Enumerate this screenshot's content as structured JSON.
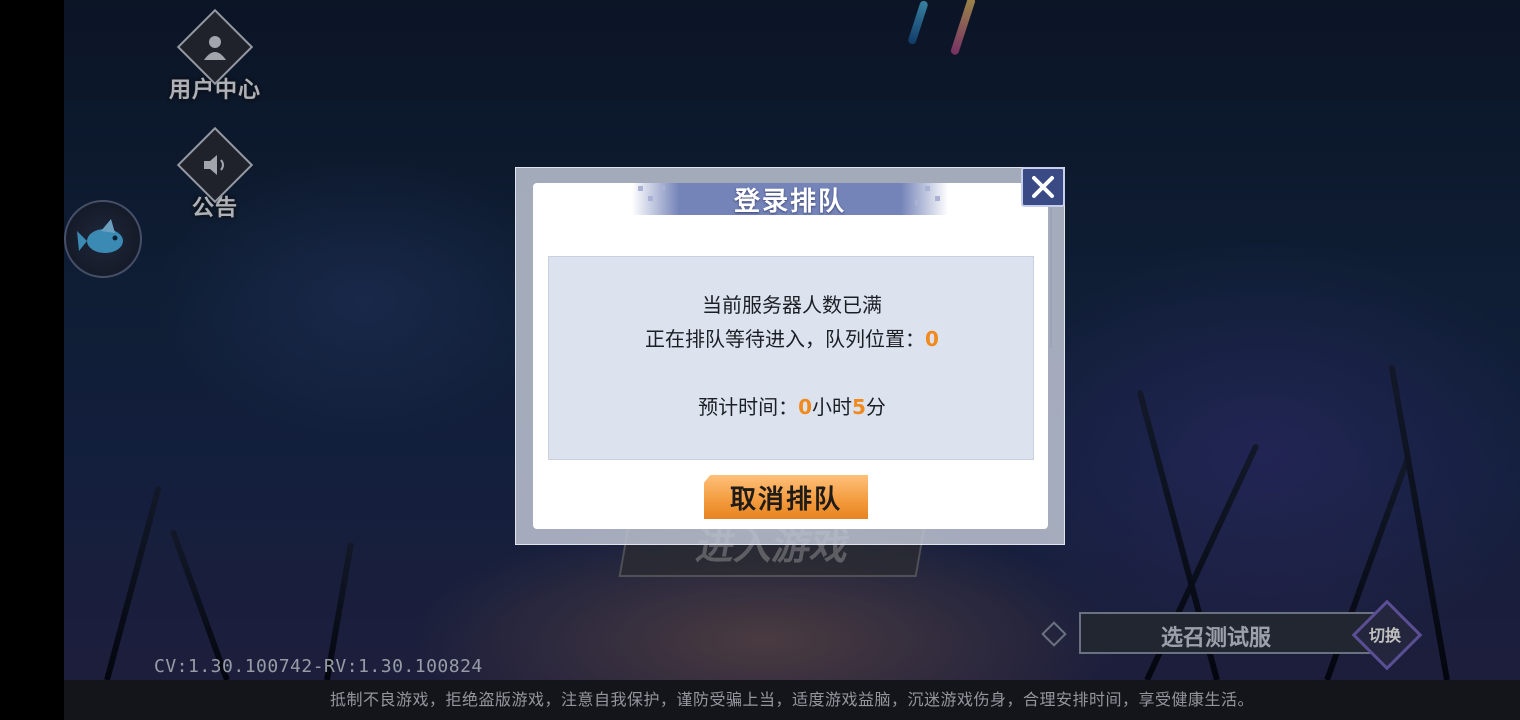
{
  "sidebar": {
    "user_center": {
      "label": "用户中心",
      "icon": "user-icon"
    },
    "announcement": {
      "label": "公告",
      "icon": "speaker-icon"
    },
    "mascot": {
      "icon": "flying-fish-icon"
    }
  },
  "background": {
    "enter_game_label": "进入游戏",
    "version": "CV:1.30.100742-RV:1.30.100824",
    "server": {
      "name": "选召测试服",
      "switch_label": "切换"
    },
    "health_notice": "抵制不良游戏，拒绝盗版游戏，注意自我保护，谨防受骗上当，适度游戏益脑，沉迷游戏伤身，合理安排时间，享受健康生活。"
  },
  "dialog": {
    "title": "登录排队",
    "line1": "当前服务器人数已满",
    "line2_prefix": "正在排队等待进入，队列位置：",
    "queue_position": "0",
    "time_prefix": "预计时间：",
    "hours": "0",
    "hours_unit": "小时",
    "minutes": "5",
    "minutes_unit": "分",
    "cancel_label": "取消排队"
  },
  "colors": {
    "accent_orange": "#f39a3c",
    "title_bar": "#7483b8",
    "message_bg": "#dde3ee",
    "highlight_number": "#f08a1e"
  }
}
